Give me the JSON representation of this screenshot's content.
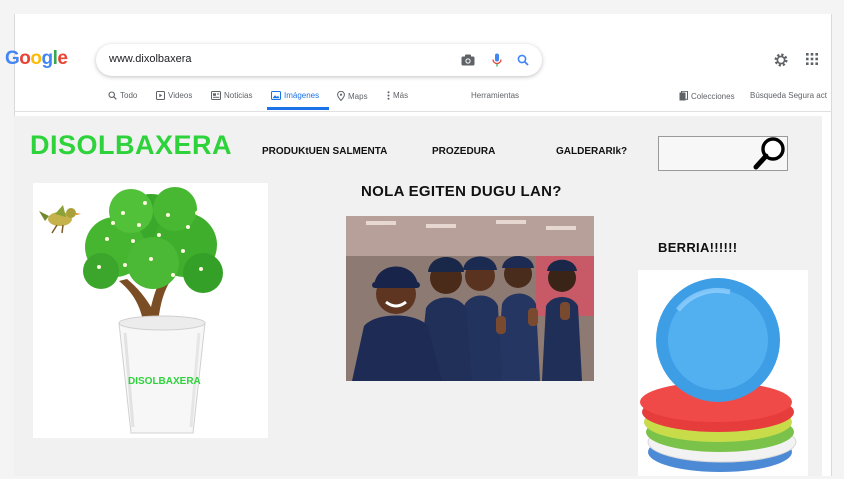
{
  "browser": {
    "logo": [
      "G",
      "o",
      "o",
      "g",
      "l",
      "e"
    ],
    "search_query": "www.dixolbaxera",
    "tabs": [
      {
        "label": "Todo",
        "icon": "search-icon"
      },
      {
        "label": "Videos",
        "icon": "video-icon"
      },
      {
        "label": "Noticias",
        "icon": "news-icon"
      },
      {
        "label": "Imágenes",
        "icon": "image-icon",
        "active": true
      },
      {
        "label": "Maps",
        "icon": "map-pin-icon"
      },
      {
        "label": "Más",
        "icon": "more-vertical-icon"
      }
    ],
    "tools_label": "Herramientas",
    "collections_label": "Colecciones",
    "safesearch_label": "Búsqueda Segura act"
  },
  "site": {
    "brand": "DISOLBAXERA",
    "nav": [
      "PRODUKtUEN SALMENTA",
      "PROZEDURA",
      "GALDERARIk?"
    ],
    "cup_label": "DISOLBAXERA",
    "heading_how": "NOLA EGITEN DUGU LAN?",
    "heading_new": "BERRIA!!!!!!"
  },
  "colors": {
    "brand_green": "#2ed33c",
    "google_blue": "#4285F4",
    "google_red": "#EA4335",
    "google_yellow": "#FBBC05",
    "google_green": "#34A853",
    "active_tab": "#1a73e8"
  }
}
